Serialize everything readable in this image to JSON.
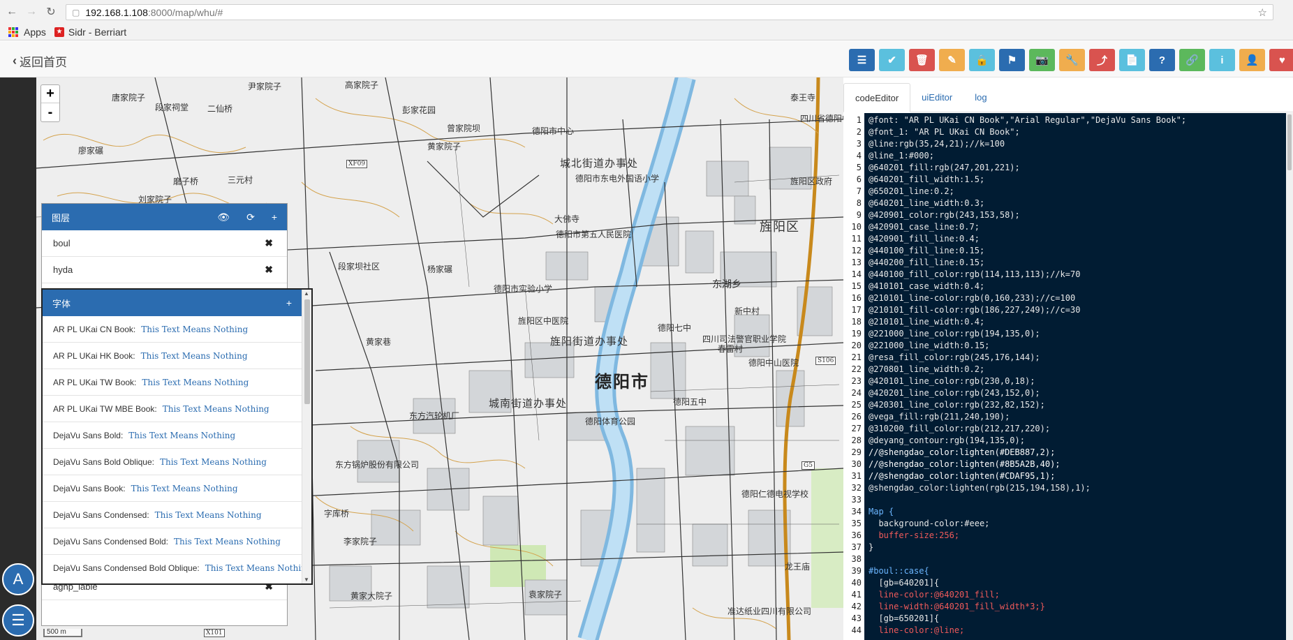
{
  "browser": {
    "url_host": "192.168.1.108",
    "url_path": ":8000/map/whu/#",
    "bookmarks": [
      {
        "label": "Apps"
      },
      {
        "label": "Sidr - Berriart"
      }
    ]
  },
  "header": {
    "back_label": "返回首页",
    "toolbar_colors": [
      "#2b6cb0",
      "#5bc0de",
      "#d9534f",
      "#f0ad4e",
      "#5bc0de",
      "#2b6cb0",
      "#5cb85c",
      "#f0ad4e",
      "#d9534f",
      "#5bc0de",
      "#2b6cb0",
      "#5cb85c",
      "#5bc0de",
      "#f0ad4e",
      "#d9534f"
    ],
    "toolbar_icons": [
      "list-icon",
      "check-icon",
      "trash-icon",
      "pencil-icon",
      "lock-icon",
      "flag-icon",
      "camera-icon",
      "wrench-icon",
      "share-icon",
      "file-icon",
      "question-icon",
      "link-icon",
      "info-icon",
      "user-icon",
      "heart-icon"
    ],
    "toolbar_glyphs": [
      "☰",
      "✔",
      "🗑",
      "✎",
      "🔒",
      "⚑",
      "📷",
      "🔧",
      "⤴",
      "📄",
      "?",
      "🔗",
      "i",
      "👤",
      "♥"
    ]
  },
  "map": {
    "zoom_in": "+",
    "zoom_out": "-",
    "scale": "500 m",
    "labels": {
      "city": "德阳市",
      "district": "旌阳区",
      "subdistrict_1": "城北街道办事处",
      "subdistrict_2": "旌阳街道办事处",
      "subdistrict_3": "城南街道办事处",
      "east_lake": "东湖乡",
      "l1": "唐家院子",
      "l2": "段家祠堂",
      "l3": "二仙桥",
      "l4": "尹家院子",
      "l5": "高家院子",
      "l6": "黄家院子",
      "l7": "彭家花园",
      "l8": "曾家院坝",
      "l9": "德阳市中心",
      "l10": "德阳市东电外国语小学",
      "l11": "德阳市第五人民医院",
      "l12": "德阳市实验小学",
      "l13": "德阳七中",
      "l14": "东方汽轮机厂",
      "l15": "德阳体育公园",
      "l16": "东方锅炉股份有限公司",
      "l17": "德阳五中",
      "l18": "德阳中山医院",
      "l19": "旌阳区中医院",
      "l20": "四川司法警官职业学院",
      "l21": "大佛寺",
      "l22": "段家坝社区",
      "l23": "杨家碾",
      "l24": "黄家巷",
      "l25": "泰王寺",
      "l26": "旌阳区政府",
      "l27": "四川省德阳中学",
      "l28": "龙王庙",
      "l29": "德阳仁德电视学校",
      "l30": "准达纸业四川有限公司",
      "l31": "黄家大院子",
      "l32": "袁家院子",
      "l33": "字库桥",
      "l34": "李家院子",
      "l35": "春雷村",
      "l36": "新中村",
      "l37": "廖家碾",
      "l38": "磨子桥",
      "l39": "三元村",
      "l40": "刘家院子",
      "r1": "XF09",
      "r2": "S106",
      "r3": "X101",
      "r4": "G5"
    }
  },
  "layers_panel": {
    "title": "图层",
    "layers": [
      "boul",
      "hyda",
      "agnp_lable"
    ]
  },
  "fonts_panel": {
    "title": "字体",
    "sample": "This Text Means Nothing",
    "fonts": [
      "AR PL UKai CN Book:",
      "AR PL UKai HK Book:",
      "AR PL UKai TW Book:",
      "AR PL UKai TW MBE Book:",
      "DejaVu Sans Bold:",
      "DejaVu Sans Bold Oblique:",
      "DejaVu Sans Book:",
      "DejaVu Sans Condensed:",
      "DejaVu Sans Condensed Bold:",
      "DejaVu Sans Condensed Bold Oblique:"
    ]
  },
  "editor": {
    "tabs": [
      "codeEditor",
      "uiEditor",
      "log"
    ],
    "lines": [
      "@font: \"AR PL UKai CN Book\",\"Arial Regular\",\"DejaVu Sans Book\";",
      "@font_1: \"AR PL UKai CN Book\";",
      "@line:rgb(35,24,21);//k=100",
      "@line_1:#000;",
      "@640201_fill:rgb(247,201,221);",
      "@640201_fill_width:1.5;",
      "@650201_line:0.2;",
      "@640201_line_width:0.3;",
      "@420901_color:rgb(243,153,58);",
      "@420901_case_line:0.7;",
      "@420901_fill_line:0.4;",
      "@440100_fill_line:0.15;",
      "@440200_fill_line:0.15;",
      "@440100_fill_color:rgb(114,113,113);//k=70",
      "@410101_case_width:0.4;",
      "@210101_line-color:rgb(0,160,233);//c=100",
      "@210101_fill-color:rgb(186,227,249);//c=30",
      "@210101_line_width:0.4;",
      "@221000_line_color:rgb(194,135,0);",
      "@221000_line_width:0.15;",
      "@resa_fill_color:rgb(245,176,144);",
      "@270801_line_width:0.2;",
      "@420101_line_color:rgb(230,0,18);",
      "@420201_line_color:rgb(243,152,0);",
      "@420301_line_color:rgb(232,82,152);",
      "@vega_fill:rgb(211,240,190);",
      "@310200_fill_color:rgb(212,217,220);",
      "@deyang_contour:rgb(194,135,0);",
      "//@shengdao_color:lighten(#DEB887,2);",
      "//@shengdao_color:lighten(#8B5A2B,40);",
      "//@shengdao_color:lighten(#CDAF95,1);",
      "@shengdao_color:lighten(rgb(215,194,158),1);",
      "",
      "Map {",
      "  background-color:#eee;",
      "  buffer-size:256;",
      "}",
      "",
      "#boul::case{",
      "  [gb=640201]{",
      "  line-color:@640201_fill;",
      "  line-width:@640201_fill_width*3;}",
      "  [gb=650201]{",
      "  line-color:@line;"
    ]
  },
  "side_buttons": {
    "a_label": "A",
    "list_glyph": "☰"
  }
}
